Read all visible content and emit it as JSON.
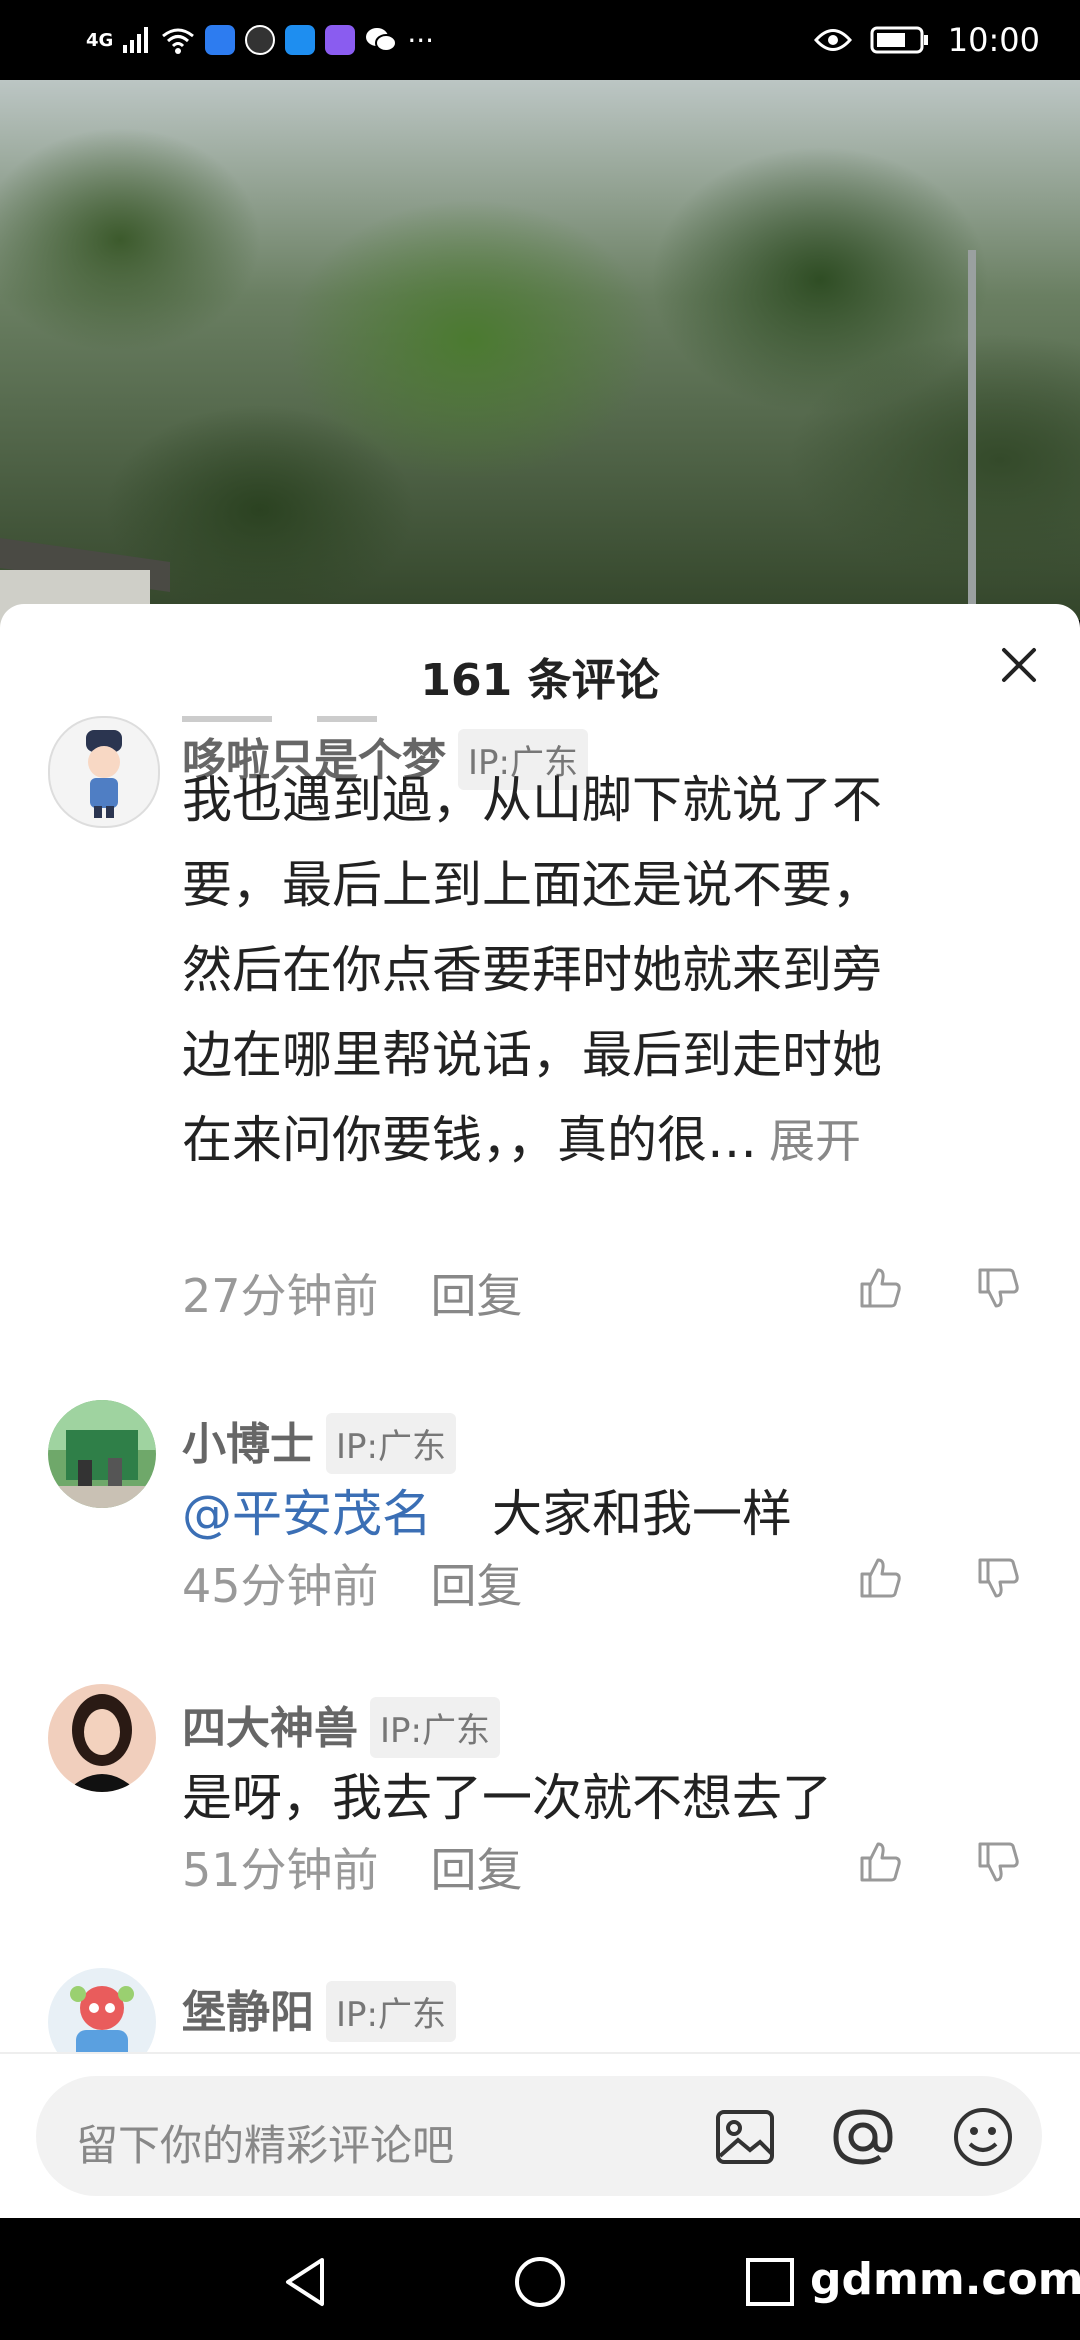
{
  "status_bar": {
    "network": "4G",
    "time": "10:00"
  },
  "sheet": {
    "title": "161 条评论"
  },
  "comments": [
    {
      "user": "哆啦只是个梦",
      "ip": "IP:广东",
      "lines": [
        "我也遇到過，从山脚下就说了不",
        "要，最后上到上面还是说不要，",
        "然后在你点香要拜时她就来到旁",
        "边在哪里帮说话，最后到走时她",
        "在来问你要钱，，真的很…"
      ],
      "expand": "展开",
      "time": "27分钟前",
      "reply": "回复"
    },
    {
      "user": "小博士",
      "ip": "IP:广东",
      "mention": "@平安茂名",
      "text": "大家和我一样",
      "time": "45分钟前",
      "reply": "回复"
    },
    {
      "user": "四大神兽",
      "ip": "IP:广东",
      "text": "是呀，我去了一次就不想去了",
      "time": "51分钟前",
      "reply": "回复"
    },
    {
      "user": "堡静阳",
      "ip": "IP:广东"
    }
  ],
  "input": {
    "placeholder": "留下你的精彩评论吧"
  },
  "watermark": "gdmm.com",
  "colors": {
    "mention": "#3b6fb5",
    "background": "#ffffff",
    "system_bar": "#000000"
  }
}
